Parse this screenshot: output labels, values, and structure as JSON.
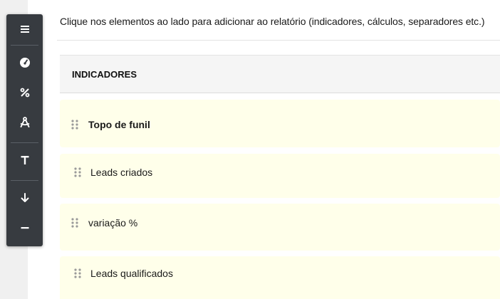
{
  "instructions": "Clique nos elementos ao lado para adicionar ao relatório (indicadores, cálculos, separadores etc.)",
  "section": {
    "title": "INDICADORES"
  },
  "items": [
    {
      "label": "Topo de funil"
    },
    {
      "label": "Leads criados"
    },
    {
      "label": "variação %"
    },
    {
      "label": "Leads qualificados"
    }
  ],
  "toolbar": {
    "icons": [
      "menu-icon",
      "gauge-icon",
      "percent-icon",
      "compass-icon",
      "text-icon",
      "arrow-down-icon",
      "minus-icon"
    ]
  },
  "colors": {
    "toolbar_bg": "#373b40",
    "item_bg": "#ffffea",
    "header_bg": "#f5f5f5"
  }
}
